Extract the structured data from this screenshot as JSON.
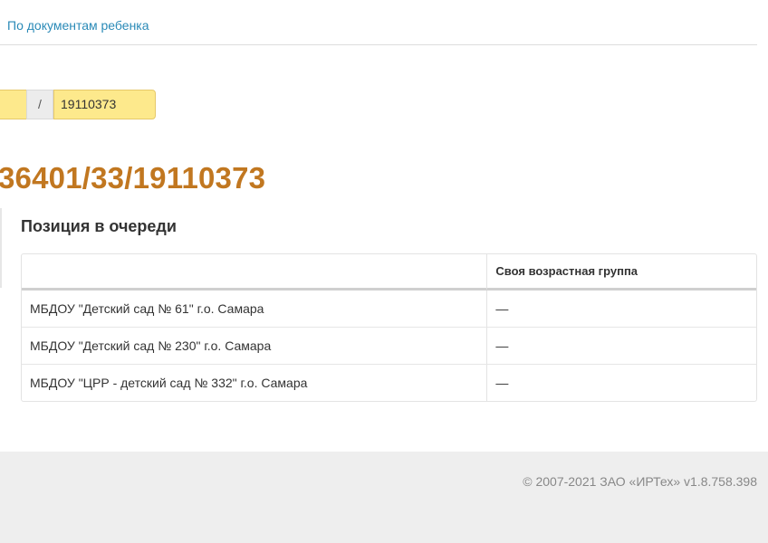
{
  "nav": {
    "tab_label": "По документам ребенка"
  },
  "number_input": {
    "separator": "/",
    "value": "19110373"
  },
  "document_number": "36401/33/19110373",
  "queue_section": {
    "title": "Позиция в очереди",
    "columns": [
      "",
      "Своя возрастная группа"
    ],
    "rows": [
      {
        "name": "МБДОУ \"Детский сад № 61\" г.о. Самара",
        "age_group": "—"
      },
      {
        "name": "МБДОУ \"Детский сад № 230\" г.о. Самара",
        "age_group": "—"
      },
      {
        "name": "МБДОУ \"ЦРР - детский сад № 332\" г.о. Самара",
        "age_group": "—"
      }
    ]
  },
  "footer": {
    "copyright": "© 2007-2021 ЗАО «ИРТех» v1.8.758.398"
  },
  "colors": {
    "link": "#2a8ab7",
    "document_number": "#c17720",
    "input_highlight": "#fde98c",
    "footer_bg": "#eeeeee"
  }
}
